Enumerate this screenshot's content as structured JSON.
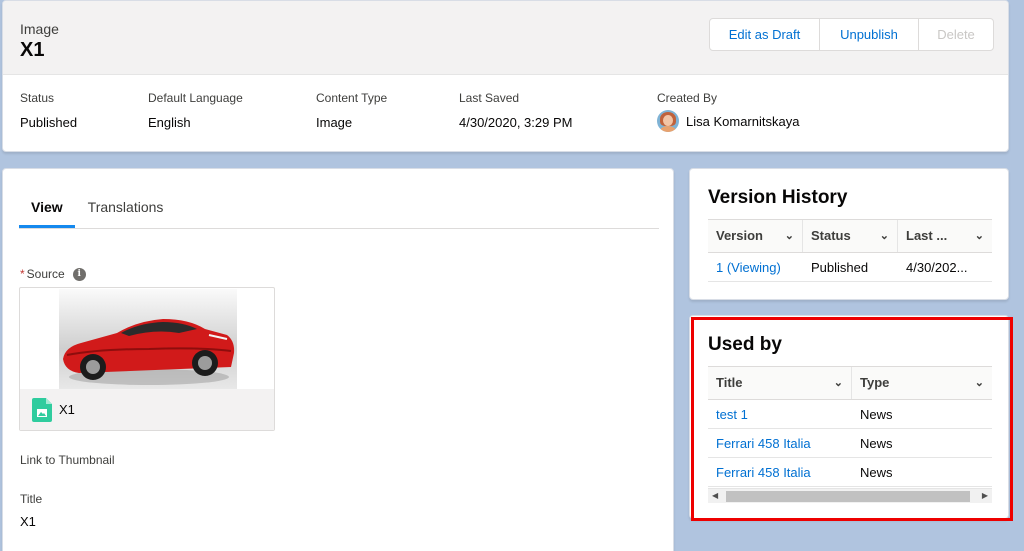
{
  "header": {
    "object_type": "Image",
    "record_title": "X1",
    "buttons": {
      "edit_as_draft": "Edit as Draft",
      "unpublish": "Unpublish",
      "delete": "Delete"
    },
    "fields": {
      "status_label": "Status",
      "status_value": "Published",
      "language_label": "Default Language",
      "language_value": "English",
      "content_type_label": "Content Type",
      "content_type_value": "Image",
      "last_saved_label": "Last Saved",
      "last_saved_value": "4/30/2020, 3:29 PM",
      "created_by_label": "Created By",
      "created_by_value": "Lisa Komarnitskaya"
    }
  },
  "main": {
    "tabs": [
      {
        "label": "View",
        "active": true
      },
      {
        "label": "Translations",
        "active": false
      }
    ],
    "source_required_mark": "*",
    "source_label": "Source",
    "info_glyph": "i",
    "image_file_name": "X1",
    "link_to_thumbnail_label": "Link to Thumbnail",
    "title_label": "Title",
    "title_value": "X1"
  },
  "version_history": {
    "title": "Version History",
    "columns": [
      "Version",
      "Status",
      "Last ..."
    ],
    "rows": [
      {
        "version": "1 (Viewing)",
        "status": "Published",
        "last": "4/30/202..."
      }
    ]
  },
  "used_by": {
    "title": "Used by",
    "columns": [
      "Title",
      "Type"
    ],
    "rows": [
      {
        "title": "test 1",
        "type": "News"
      },
      {
        "title": "Ferrari 458 Italia",
        "type": "News"
      },
      {
        "title": "Ferrari 458 Italia",
        "type": "News"
      }
    ]
  },
  "colors": {
    "page_background": "#b0c4df",
    "link": "#0070d2",
    "active_tab_underline": "#1589ee",
    "highlight_box": "#ee0000",
    "required_mark": "#c23934"
  },
  "icons": [
    "info-icon",
    "chevron-down-icon",
    "image-file-icon",
    "scroll-left-arrow-icon",
    "scroll-right-arrow-icon"
  ]
}
